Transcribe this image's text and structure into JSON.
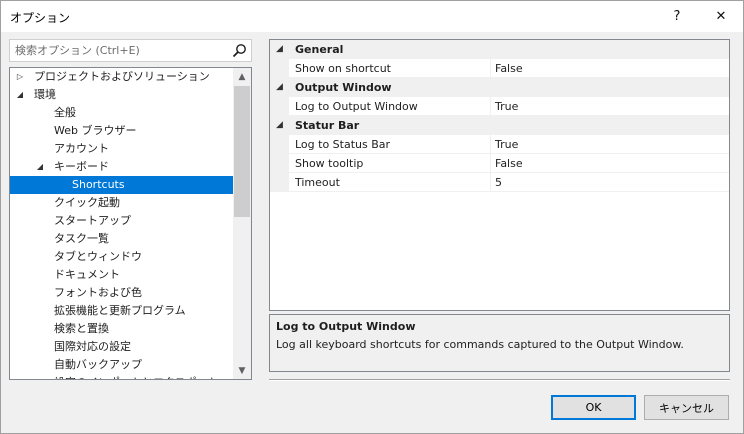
{
  "window": {
    "title": "オプション",
    "help_label": "?",
    "close_label": "✕"
  },
  "search": {
    "placeholder": "検索オプション (Ctrl+E)"
  },
  "tree": {
    "items": [
      {
        "label": "プロジェクトおよびソリューション",
        "level": 0,
        "arrow": "▷",
        "selected": false
      },
      {
        "label": "環境",
        "level": 0,
        "arrow": "◢",
        "selected": false
      },
      {
        "label": "全般",
        "level": 1,
        "arrow": "",
        "selected": false
      },
      {
        "label": "Web ブラウザー",
        "level": 1,
        "arrow": "",
        "selected": false
      },
      {
        "label": "アカウント",
        "level": 1,
        "arrow": "",
        "selected": false
      },
      {
        "label": "キーボード",
        "level": 1,
        "arrow": "◢",
        "selected": false
      },
      {
        "label": "Shortcuts",
        "level": 2,
        "arrow": "",
        "selected": true
      },
      {
        "label": "クイック起動",
        "level": 1,
        "arrow": "",
        "selected": false
      },
      {
        "label": "スタートアップ",
        "level": 1,
        "arrow": "",
        "selected": false
      },
      {
        "label": "タスク一覧",
        "level": 1,
        "arrow": "",
        "selected": false
      },
      {
        "label": "タブとウィンドウ",
        "level": 1,
        "arrow": "",
        "selected": false
      },
      {
        "label": "ドキュメント",
        "level": 1,
        "arrow": "",
        "selected": false
      },
      {
        "label": "フォントおよび色",
        "level": 1,
        "arrow": "",
        "selected": false
      },
      {
        "label": "拡張機能と更新プログラム",
        "level": 1,
        "arrow": "",
        "selected": false
      },
      {
        "label": "検索と置換",
        "level": 1,
        "arrow": "",
        "selected": false
      },
      {
        "label": "国際対応の設定",
        "level": 1,
        "arrow": "",
        "selected": false
      },
      {
        "label": "自動バックアップ",
        "level": 1,
        "arrow": "",
        "selected": false
      },
      {
        "label": "設定のインポートとエクスポート",
        "level": 1,
        "arrow": "",
        "selected": false
      }
    ]
  },
  "properties": {
    "rows": [
      {
        "type": "category",
        "label": "General",
        "arrow": "◢"
      },
      {
        "type": "property",
        "name": "Show on shortcut",
        "value": "False"
      },
      {
        "type": "category",
        "label": "Output Window",
        "arrow": "◢"
      },
      {
        "type": "property",
        "name": "Log to Output Window",
        "value": "True"
      },
      {
        "type": "category",
        "label": "Statur Bar",
        "arrow": "◢"
      },
      {
        "type": "property",
        "name": "Log to Status Bar",
        "value": "True"
      },
      {
        "type": "property",
        "name": "Show tooltip",
        "value": "False"
      },
      {
        "type": "property",
        "name": "Timeout",
        "value": "5"
      }
    ]
  },
  "description": {
    "title": "Log to Output Window",
    "text": "Log all keyboard shortcuts for commands captured to the Output Window."
  },
  "buttons": {
    "ok": "OK",
    "cancel": "キャンセル"
  },
  "colors": {
    "selection": "#0078d7",
    "dialog_bg": "#f0f0f0"
  }
}
